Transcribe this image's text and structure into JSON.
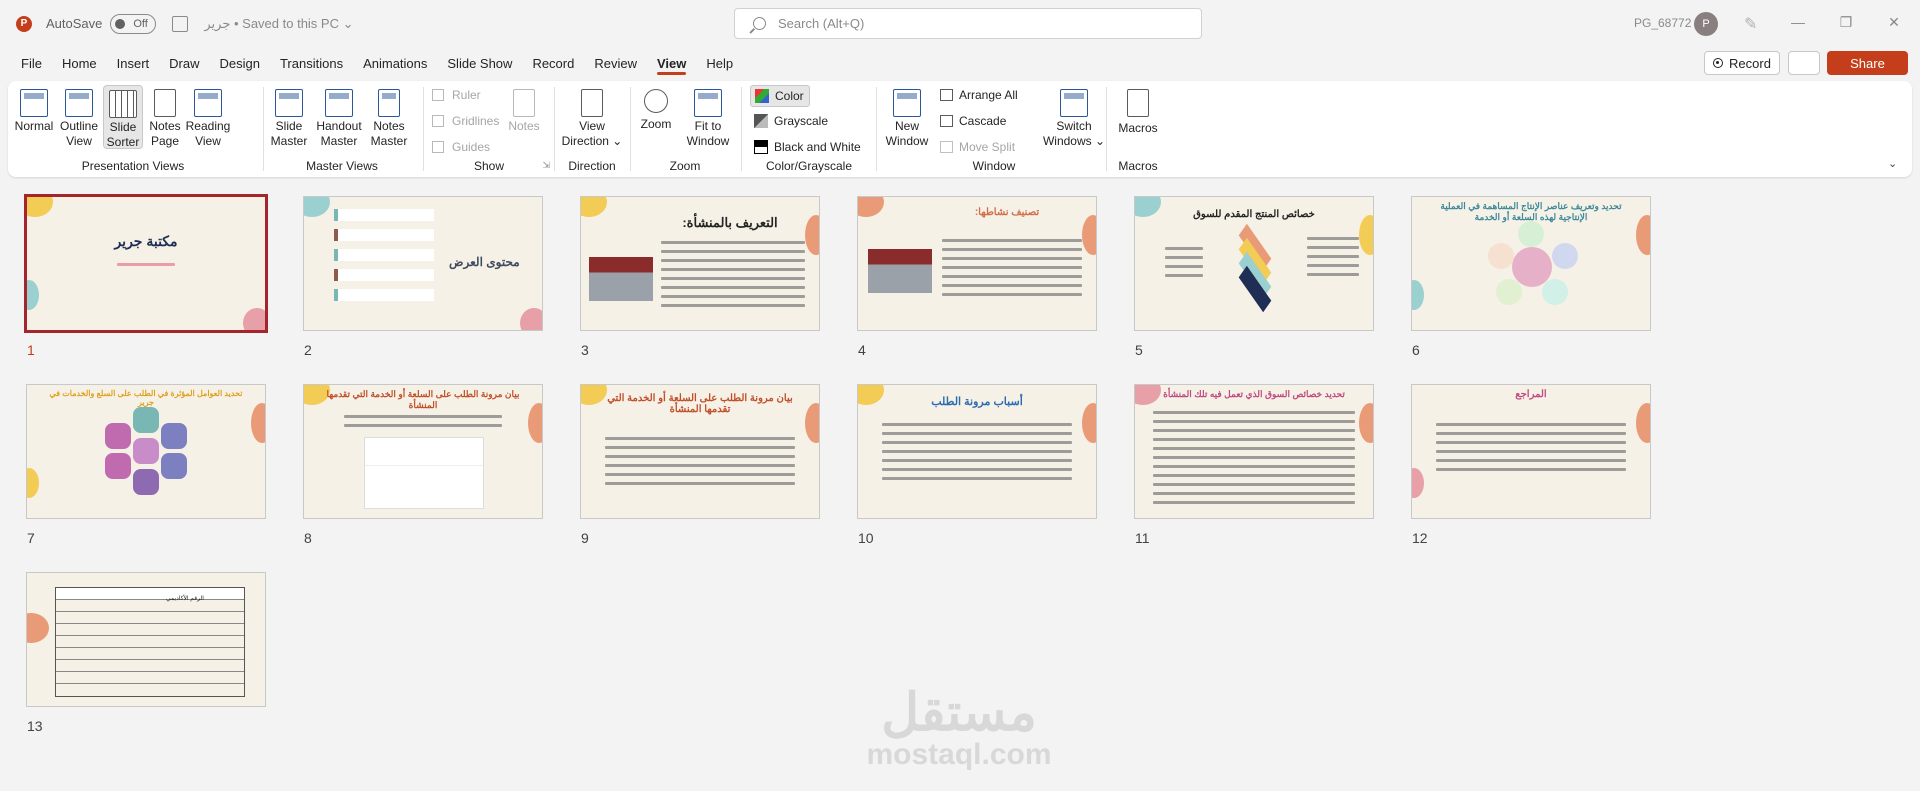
{
  "titlebar": {
    "autosave_label": "AutoSave",
    "autosave_state": "Off",
    "doc_title": "جرير • Saved to this PC ⌄",
    "search_placeholder": "Search (Alt+Q)",
    "user_name": "PG_68772",
    "avatar_initial": "P",
    "minimize": "—",
    "restore": "❐",
    "close": "✕",
    "app_icon_letter": "P"
  },
  "menu": {
    "tabs": [
      "File",
      "Home",
      "Insert",
      "Draw",
      "Design",
      "Transitions",
      "Animations",
      "Slide Show",
      "Record",
      "Review",
      "View",
      "Help"
    ],
    "active_tab": "View",
    "record_label": "Record",
    "share_label": "Share"
  },
  "ribbon": {
    "presentation_views": {
      "label": "Presentation Views",
      "normal": "Normal",
      "outline": "Outline View",
      "outline_l1": "Outline",
      "outline_l2": "View",
      "sorter_l1": "Slide",
      "sorter_l2": "Sorter",
      "notes_l1": "Notes",
      "notes_l2": "Page",
      "reading_l1": "Reading",
      "reading_l2": "View"
    },
    "master_views": {
      "label": "Master Views",
      "slide_l1": "Slide",
      "slide_l2": "Master",
      "handout_l1": "Handout",
      "handout_l2": "Master",
      "notes_l1": "Notes",
      "notes_l2": "Master"
    },
    "show": {
      "label": "Show",
      "ruler": "Ruler",
      "gridlines": "Gridlines",
      "guides": "Guides",
      "notes": "Notes"
    },
    "direction": {
      "label": "Direction",
      "view_l1": "View",
      "view_l2": "Direction ⌄"
    },
    "zoom": {
      "label": "Zoom",
      "zoom": "Zoom",
      "fit_l1": "Fit to",
      "fit_l2": "Window"
    },
    "color": {
      "label": "Color/Grayscale",
      "color": "Color",
      "grayscale": "Grayscale",
      "bw": "Black and White"
    },
    "window": {
      "label": "Window",
      "new_l1": "New",
      "new_l2": "Window",
      "arrange_all": "Arrange All",
      "cascade": "Cascade",
      "move_split": "Move Split",
      "switch_l1": "Switch",
      "switch_l2": "Windows ⌄"
    },
    "macros": {
      "label": "Macros",
      "macros": "Macros"
    }
  },
  "slides": [
    {
      "num": "1",
      "title": "مكتبة جرير"
    },
    {
      "num": "2",
      "title": "محتوى العرض"
    },
    {
      "num": "3",
      "title": "التعريف بالمنشأة:"
    },
    {
      "num": "4",
      "title": "تصنيف نشاطها:"
    },
    {
      "num": "5",
      "title": "خصائص المنتج المقدم للسوق"
    },
    {
      "num": "6",
      "title": "تحديد وتعريف عناصر الإنتاج المساهمة في العملية الإنتاجية لهذه السلعة أو الخدمة"
    },
    {
      "num": "7",
      "title": "تحديد العوامل المؤثرة في الطلب على السلع والخدمات في جرير"
    },
    {
      "num": "8",
      "title": "بيان مرونة الطلب على السلعة أو الخدمة التي تقدمها المنشأة"
    },
    {
      "num": "9",
      "title": "بيان مرونة الطلب على السلعة أو الخدمة التي تقدمها المنشأة"
    },
    {
      "num": "10",
      "title": "أسباب مرونة الطلب"
    },
    {
      "num": "11",
      "title": "تحديد خصائص السوق الذي تعمل فيه تلك المنشأة"
    },
    {
      "num": "12",
      "title": "المراجع"
    },
    {
      "num": "13",
      "title": "الرقم الأكاديمي"
    }
  ],
  "watermark": {
    "arabic": "مستقل",
    "latin": "mostaql.com"
  },
  "colors": {
    "accent": "#c43e1c",
    "selected_slide": "#a4262c",
    "share_bg": "#c43e1c"
  }
}
